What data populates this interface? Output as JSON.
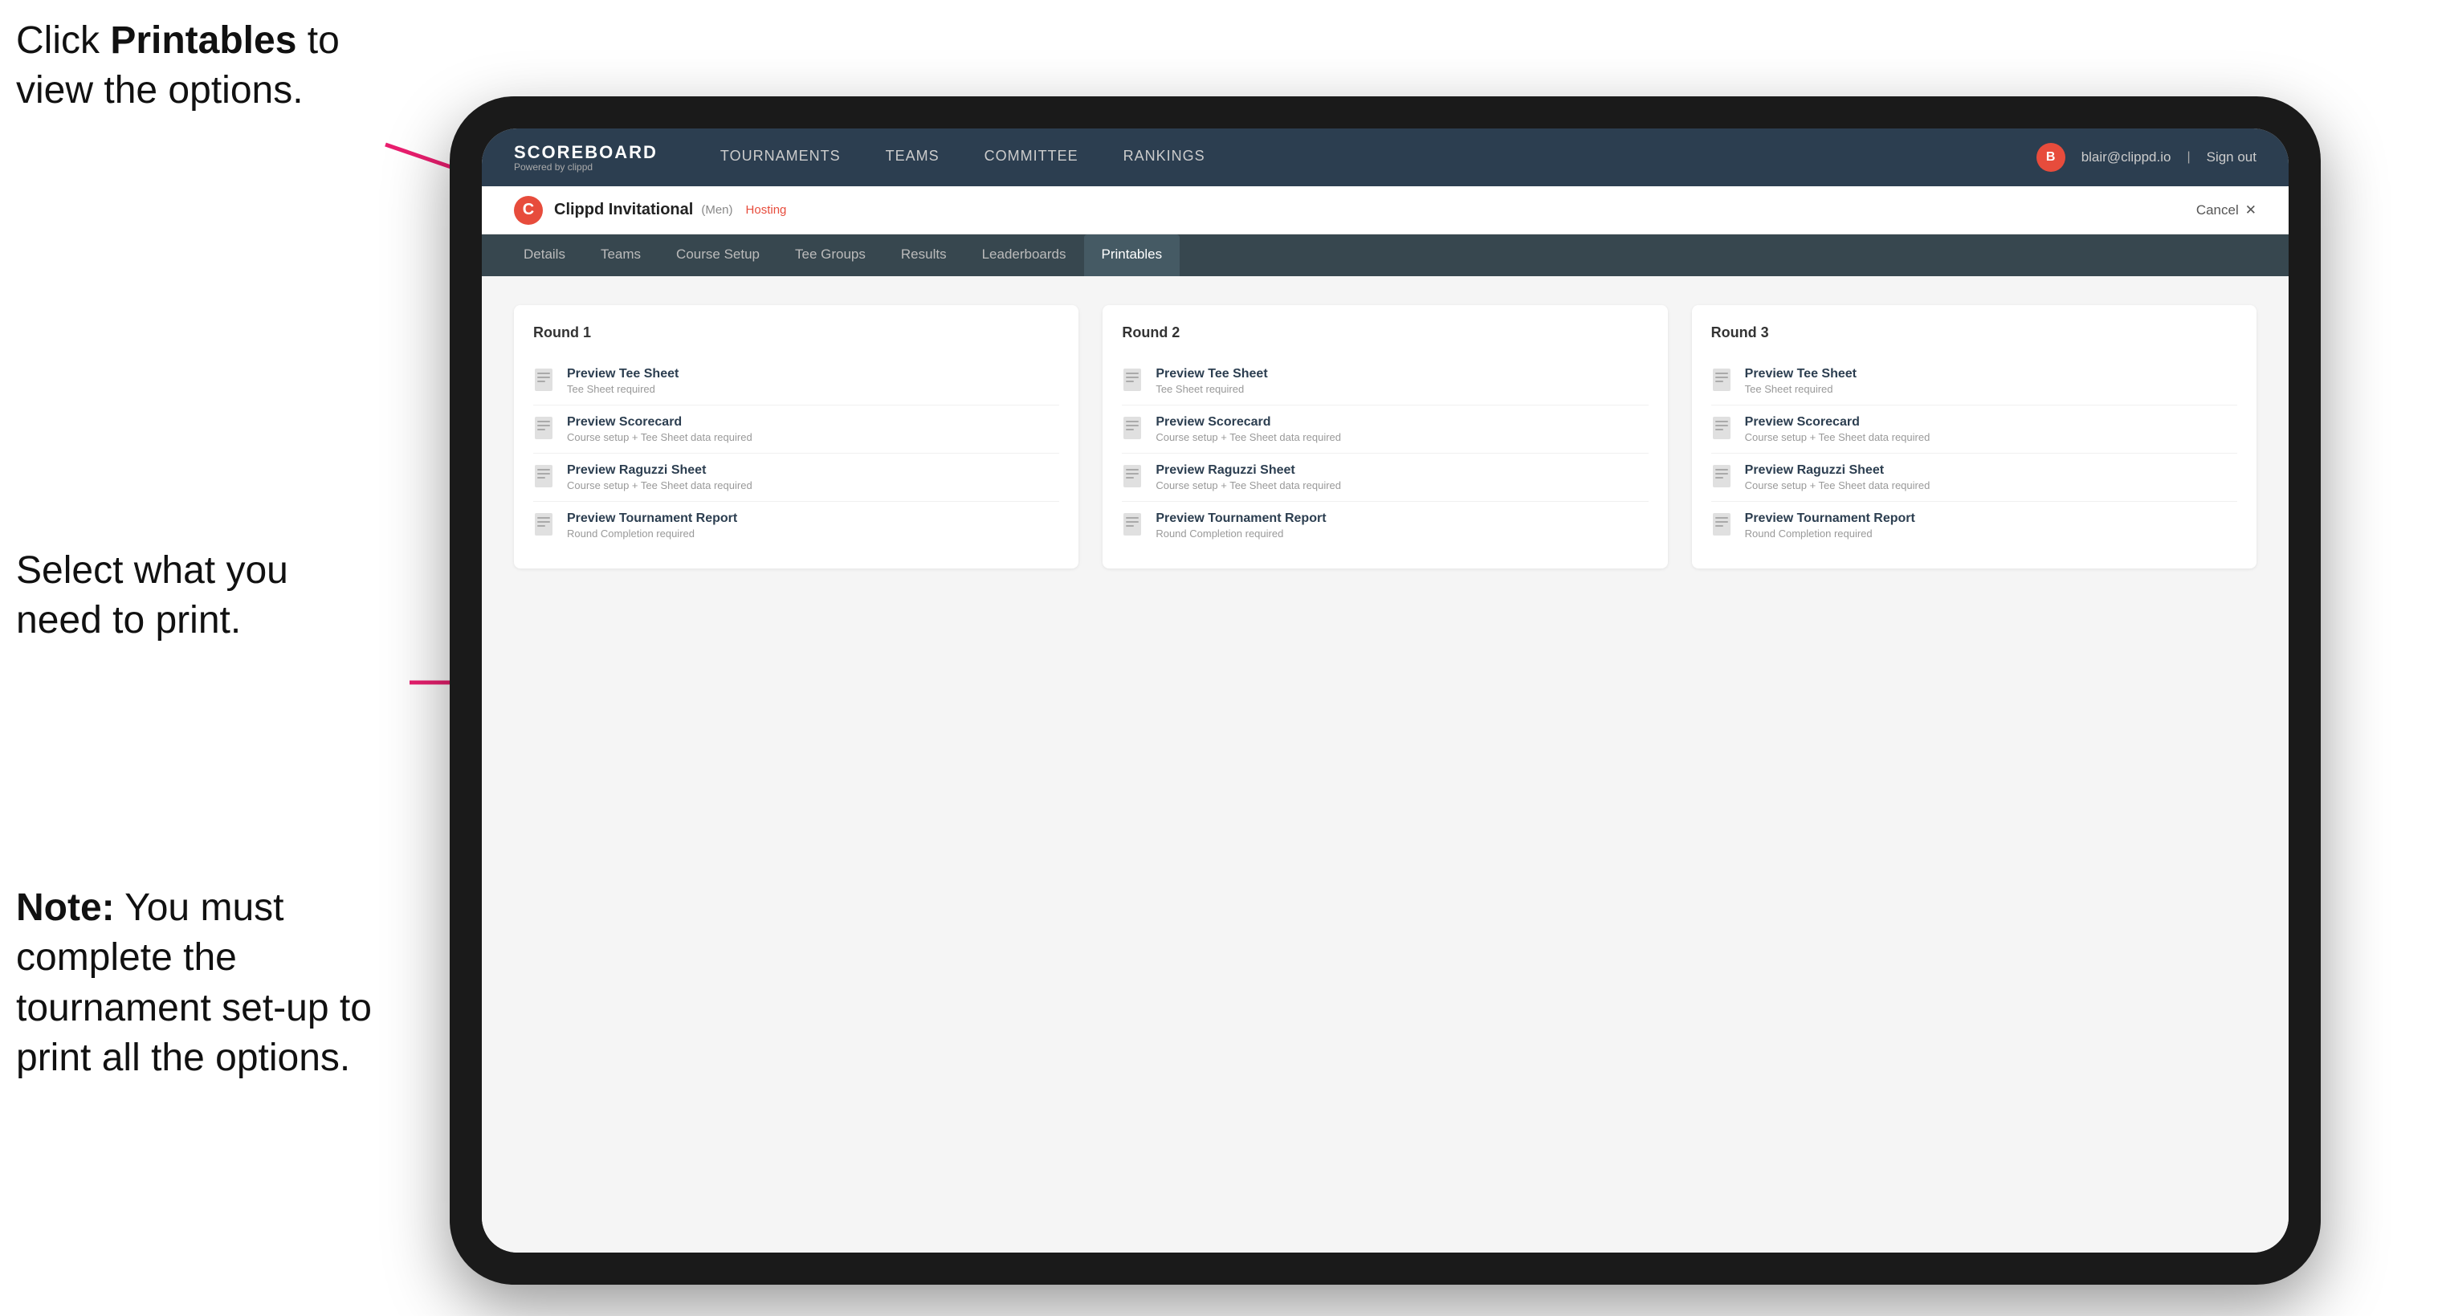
{
  "annotations": {
    "top": {
      "prefix": "Click ",
      "bold": "Printables",
      "suffix": " to view the options."
    },
    "middle": "Select what you need to print.",
    "bottom": {
      "bold": "Note:",
      "suffix": " You must complete the tournament set-up to print all the options."
    }
  },
  "nav": {
    "brand": "SCOREBOARD",
    "brand_sub": "Powered by clippd",
    "items": [
      {
        "label": "TOURNAMENTS",
        "active": false
      },
      {
        "label": "TEAMS",
        "active": false
      },
      {
        "label": "COMMITTEE",
        "active": false
      },
      {
        "label": "RANKINGS",
        "active": false
      }
    ],
    "user_email": "blair@clippd.io",
    "sign_out": "Sign out"
  },
  "sub_header": {
    "tournament_name": "Clippd Invitational",
    "tournament_type": "(Men)",
    "status": "Hosting",
    "cancel": "Cancel"
  },
  "tabs": [
    {
      "label": "Details",
      "active": false
    },
    {
      "label": "Teams",
      "active": false
    },
    {
      "label": "Course Setup",
      "active": false
    },
    {
      "label": "Tee Groups",
      "active": false
    },
    {
      "label": "Results",
      "active": false
    },
    {
      "label": "Leaderboards",
      "active": false
    },
    {
      "label": "Printables",
      "active": true
    }
  ],
  "rounds": [
    {
      "title": "Round 1",
      "items": [
        {
          "title": "Preview Tee Sheet",
          "sub": "Tee Sheet required"
        },
        {
          "title": "Preview Scorecard",
          "sub": "Course setup + Tee Sheet data required"
        },
        {
          "title": "Preview Raguzzi Sheet",
          "sub": "Course setup + Tee Sheet data required"
        },
        {
          "title": "Preview Tournament Report",
          "sub": "Round Completion required"
        }
      ]
    },
    {
      "title": "Round 2",
      "items": [
        {
          "title": "Preview Tee Sheet",
          "sub": "Tee Sheet required"
        },
        {
          "title": "Preview Scorecard",
          "sub": "Course setup + Tee Sheet data required"
        },
        {
          "title": "Preview Raguzzi Sheet",
          "sub": "Course setup + Tee Sheet data required"
        },
        {
          "title": "Preview Tournament Report",
          "sub": "Round Completion required"
        }
      ]
    },
    {
      "title": "Round 3",
      "items": [
        {
          "title": "Preview Tee Sheet",
          "sub": "Tee Sheet required"
        },
        {
          "title": "Preview Scorecard",
          "sub": "Course setup + Tee Sheet data required"
        },
        {
          "title": "Preview Raguzzi Sheet",
          "sub": "Course setup + Tee Sheet data required"
        },
        {
          "title": "Preview Tournament Report",
          "sub": "Round Completion required"
        }
      ]
    }
  ]
}
